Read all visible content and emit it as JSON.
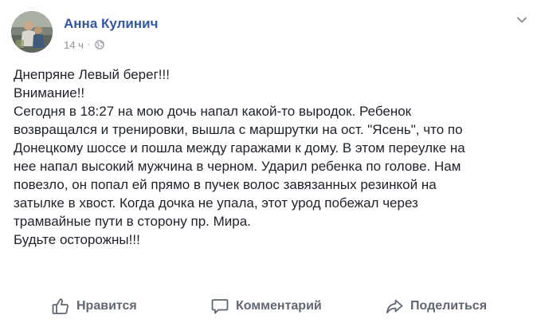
{
  "post": {
    "author": "Анна Кулинич",
    "timestamp": "14 ч",
    "separator": "·",
    "privacy_icon": "globe-icon",
    "menu_icon": "chevron-down-icon",
    "text_lines": [
      "Днепряне Левый берег!!!",
      "Внимание!!",
      "Сегодня в 18:27 на мою дочь напал какой-то выродок. Ребенок",
      "возвращался и тренировки, вышла с маршрутки на ост. \"Ясень\", что по",
      "Донецкому шоссе и пошла между гаражами к дому. В этом переулке на",
      "нее напал высокий мужчина в черном. Ударил ребенка по голове. Нам",
      "повезло, он попал ей прямо в пучек волос завязанных резинкой на",
      "затылке в хвост. Когда дочка не упала, этот урод побежал через",
      "трамвайные пути в сторону пр. Мира.",
      "Будьте осторожны!!!"
    ]
  },
  "actions": {
    "like_label": "Нравится",
    "comment_label": "Комментарий",
    "share_label": "Поделиться",
    "like_icon": "thumbs-up-icon",
    "comment_icon": "speech-bubble-icon",
    "share_icon": "share-arrow-icon"
  },
  "colors": {
    "author_link": "#365899",
    "meta_text": "#90949c",
    "body_text": "#1d2129",
    "action_text": "#606770"
  }
}
